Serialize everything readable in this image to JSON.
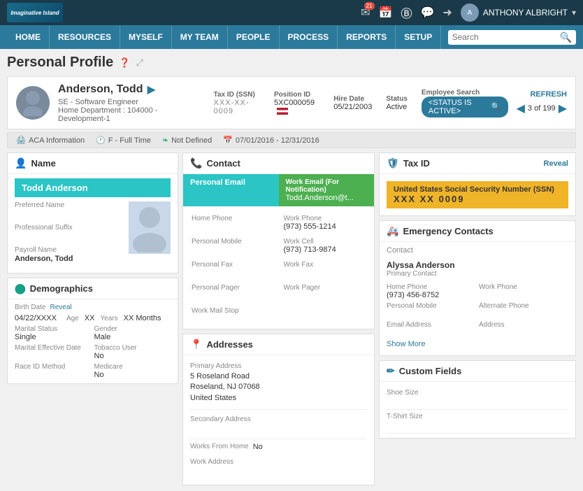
{
  "topBar": {
    "logo": "Imaginative Island",
    "icons": [
      {
        "name": "mail-icon",
        "symbol": "✉",
        "badge": "21"
      },
      {
        "name": "calendar-icon",
        "symbol": "📅",
        "badge": null
      },
      {
        "name": "user-circle-icon",
        "symbol": "Ⓑ",
        "badge": null
      },
      {
        "name": "chat-icon",
        "symbol": "💬",
        "badge": null
      },
      {
        "name": "logout-icon",
        "symbol": "➜",
        "badge": null
      }
    ],
    "userName": "ANTHONY ALBRIGHT"
  },
  "nav": {
    "items": [
      "HOME",
      "RESOURCES",
      "MYSELF",
      "MY TEAM",
      "PEOPLE",
      "PROCESS",
      "REPORTS",
      "SETUP"
    ],
    "searchPlaceholder": "Search"
  },
  "pageTitle": "Personal Profile",
  "profile": {
    "name": "Anderson, Todd",
    "role": "SE - Software Engineer",
    "dept": "Home Department : 104000 - Development-1",
    "taxIdLabel": "Tax ID (SSN)",
    "taxIdValue": "XXX-XX-0009",
    "positionIdLabel": "Position ID",
    "positionIdValue": "5XC000059",
    "hireDateLabel": "Hire Date",
    "hireDateValue": "05/21/2003",
    "statusLabel": "Status",
    "statusValue": "Active",
    "employeeSearchLabel": "Employee Search",
    "statusBadge": "<STATUS IS ACTIVE>",
    "refreshLabel": "REFRESH",
    "pageCount": "3 of 199"
  },
  "infoBar": {
    "acaLabel": "ACA Information",
    "typeLabel": "F - Full Time",
    "notDefined": "Not Defined",
    "dateRange": "07/01/2016 - 12/31/2016"
  },
  "nameSection": {
    "title": "Name",
    "highlightName": "Todd Anderson",
    "fields": [
      {
        "label": "Preferred Name",
        "value": ""
      },
      {
        "label": "Professional Suffix",
        "value": ""
      },
      {
        "label": "Payroll Name",
        "value": "Anderson, Todd"
      }
    ]
  },
  "contactSection": {
    "title": "Contact",
    "personalEmailLabel": "Personal Email",
    "workEmailLabel": "Work Email (For Notification)",
    "workEmailValue": "Todd.Anderson@t...",
    "fields": [
      {
        "label": "Home Phone",
        "value": ""
      },
      {
        "label": "Work Phone",
        "value": "(973) 555-1214"
      },
      {
        "label": "Personal Mobile",
        "value": ""
      },
      {
        "label": "Work Cell",
        "value": "(973) 713-9874"
      },
      {
        "label": "Personal Fax",
        "value": ""
      },
      {
        "label": "Work Fax",
        "value": ""
      },
      {
        "label": "Personal Pager",
        "value": ""
      },
      {
        "label": "Work Pager",
        "value": ""
      },
      {
        "label": "Work Mail Stop",
        "value": ""
      }
    ]
  },
  "taxSection": {
    "title": "Tax ID",
    "revealLabel": "Reveal",
    "taxType": "United States Social Security Number (SSN)",
    "taxMasked": "XXX XX 0009"
  },
  "emergencySection": {
    "title": "Emergency Contacts",
    "contactLabel": "Contact",
    "name": "Alyssa Anderson",
    "role": "Primary Contact",
    "fields": [
      {
        "label": "Home Phone",
        "value": "(973) 456-8752"
      },
      {
        "label": "Work Phone",
        "value": ""
      },
      {
        "label": "Personal Mobile",
        "value": ""
      },
      {
        "label": "Alternate Phone",
        "value": ""
      },
      {
        "label": "Email Address",
        "value": ""
      },
      {
        "label": "",
        "value": ""
      },
      {
        "label": "Address",
        "value": ""
      }
    ],
    "showMoreLabel": "Show More"
  },
  "demographicsSection": {
    "title": "Demographics",
    "birthDateLabel": "Birth Date",
    "birthDateRevealLabel": "Reveal",
    "birthDateValue": "04/22/XXXX",
    "ageLabel": "Age",
    "ageValue": "XX",
    "yearsLabel": "Years",
    "monthsLabel": "XX Months",
    "fields": [
      {
        "label": "Marital Status",
        "value": "Single"
      },
      {
        "label": "Gender",
        "value": "Male"
      },
      {
        "label": "Marital Effective Date",
        "value": ""
      },
      {
        "label": "Tobacco User",
        "value": "No"
      },
      {
        "label": "Race ID Method",
        "value": ""
      },
      {
        "label": "Medicare",
        "value": "No"
      }
    ]
  },
  "addressSection": {
    "title": "Addresses",
    "primaryLabel": "Primary Address",
    "primaryValue": "5 Roseland Road\nRoseland, NJ 07068\nUnited States",
    "secondaryLabel": "Secondary Address",
    "secondaryValue": "",
    "wfhLabel": "Works From Home",
    "wfhValue": "No",
    "workAddressLabel": "Work Address",
    "workAddressValue": ""
  },
  "customFieldsSection": {
    "title": "Custom Fields",
    "fields": [
      {
        "label": "Shoe Size",
        "value": ""
      },
      {
        "label": "T-Shirt Size",
        "value": ""
      }
    ]
  }
}
